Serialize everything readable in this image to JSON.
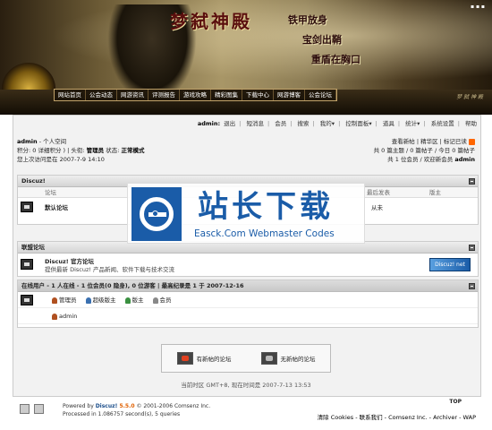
{
  "banner": {
    "title": "梦弑神殿",
    "slogan1": "铁甲放身",
    "slogan2": "宝剑出鞘",
    "slogan3": "重盾在胸口",
    "tiny": "▪ ▪ ▪",
    "signature": "梦 弑 神 殿"
  },
  "topnav": [
    "网站首页",
    "公会动态",
    "网游资讯",
    "评测报告",
    "游戏攻略",
    "精彩图集",
    "下载中心",
    "网游博客",
    "公会论坛"
  ],
  "toolbar": {
    "user": "admin:",
    "items": [
      "退出",
      "短消息",
      "会员",
      "搜索",
      "我的▾",
      "控制面板▾",
      "道具",
      "统计▾",
      "系统设置",
      "帮助"
    ]
  },
  "userbox": {
    "name": "admin",
    "space": "- 个人空间",
    "line2a": "积分: 0 详细积分 ) | 头衔: ",
    "title": "管理员",
    "line2b": " 状态: ",
    "status": "正常模式",
    "line3": "您上次访问是在 2007-7-9 14:10"
  },
  "rightinfo": {
    "line1": "查看新帖 | 精华区 | 标记已读",
    "line2": "共 0 篇主题 / 0 篇帖子 / 今日 0 篇帖子",
    "line3": "共 1 位会员 / 欢迎新会员 ",
    "newmember": "admin"
  },
  "section1": {
    "head": "Discuz!",
    "col_forum": "论坛",
    "col_last": "最后发表",
    "col_mod": "版主",
    "forum_name": "默认论坛",
    "last": "从未"
  },
  "section2": {
    "head": "联盟论坛",
    "name": "Discuz! 官方论坛",
    "desc": "提供最新 Discuz! 产品新闻、软件下载与技术交流",
    "logo": "Discuz! net"
  },
  "online": {
    "head": "在线用户 - 1 人在线 - 1 位会员(0 隐身), 0 位游客 | 最高纪录是 1 于 2007-12-16",
    "legend": [
      "管理员",
      "超级版主",
      "版主",
      "会员"
    ],
    "user": "admin"
  },
  "legend": {
    "new": "有新帖的论坛",
    "none": "无新帖的论坛"
  },
  "time": "当前时区 GMT+8, 现在时间是 2007-7-13 13:53",
  "footer": {
    "powered": "Powered by ",
    "brand": "Discuz!",
    "ver": " 5.5.0",
    "copy": " © 2001-2006 Comsenz Inc.",
    "processed": "Processed in 1.086757 second(s), 5 queries",
    "links": "清除 Cookies - 联系我们 - Comsenz Inc. - Archiver - WAP",
    "top": "TOP"
  },
  "watermark": {
    "title": "站长下载",
    "sub": "Easck.Com Webmaster Codes"
  },
  "colors": {
    "accent": "#1a5ca8",
    "banner_title": "#5a0e0e"
  }
}
